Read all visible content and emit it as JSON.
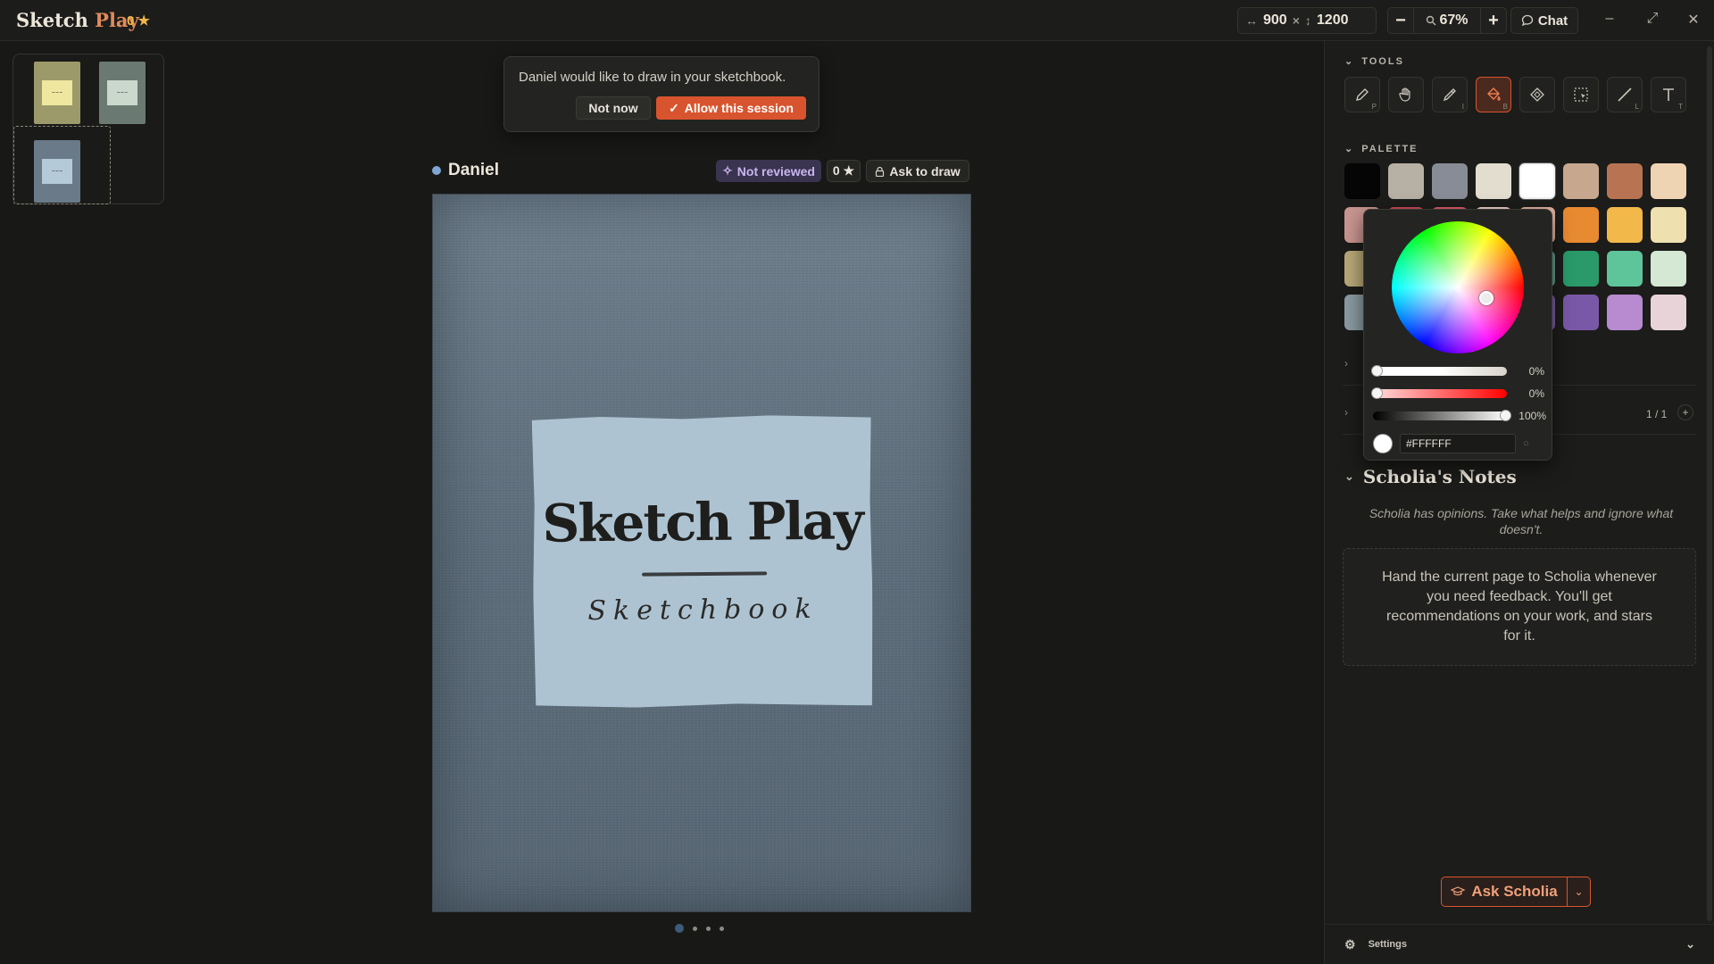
{
  "app": {
    "title_main": "Sketch ",
    "title_accent": "Play",
    "stars": "0 ★"
  },
  "topbar": {
    "width_value": "900",
    "height_value": "1200",
    "zoom_minus": "−",
    "zoom_value": "67%",
    "zoom_plus": "+",
    "chat_label": "Chat"
  },
  "consent": {
    "message": "Daniel would like to draw in your sketchbook.",
    "deny_label": "Not now",
    "allow_label": "Allow this session"
  },
  "page_header": {
    "author": "Daniel",
    "review_status": "Not reviewed",
    "stars": "0 ★",
    "ask_label": "Ask to draw"
  },
  "cover": {
    "title": "Sketch Play",
    "subtitle": "Sketchbook"
  },
  "tools": {
    "heading": "TOOLS",
    "items": [
      {
        "name": "pencil",
        "key": "P"
      },
      {
        "name": "hand",
        "key": ""
      },
      {
        "name": "eyedropper",
        "key": "I"
      },
      {
        "name": "fill",
        "key": "B"
      },
      {
        "name": "eraser",
        "key": ""
      },
      {
        "name": "select",
        "key": ""
      },
      {
        "name": "line",
        "key": "L"
      },
      {
        "name": "text",
        "key": "T"
      }
    ]
  },
  "palette": {
    "heading": "PALETTE",
    "colors": [
      "#050505",
      "#b7b0a4",
      "#878c96",
      "#e3ddd0",
      "#ffffff",
      "#c7a88e",
      "#b87452",
      "#efd4b4",
      "#c99590",
      "#c44a58",
      "#d85a6a",
      "#e8cfc8",
      "#e0b0a0",
      "#e88a30",
      "#f2b84a",
      "#efe0b0",
      "#b8a878",
      "#7a8a5a",
      "#6a8a70",
      "#a8b898",
      "#5a9a88",
      "#2a9a6a",
      "#5ec49a",
      "#d4e8d4",
      "#8a9aa0",
      "#5a6a90",
      "#6a70a8",
      "#9a88c0",
      "#7a5aa8",
      "#7a58a8",
      "#b88ad0",
      "#e8d4d8"
    ],
    "selected": "#ffffff"
  },
  "color_picker": {
    "saturation": "0%",
    "red": "0%",
    "brightness": "100%",
    "hex": "#FFFFFF"
  },
  "layers": {
    "count": "1 / 1"
  },
  "notes": {
    "title": "Scholia's Notes",
    "subtitle": "Scholia has opinions. Take what helps and ignore what doesn't.",
    "body": "Hand the current page to Scholia whenever you need feedback. You'll get recommendations on your work, and stars for it.",
    "ask_label": "Ask Scholia"
  },
  "settings": {
    "label": "Settings"
  }
}
